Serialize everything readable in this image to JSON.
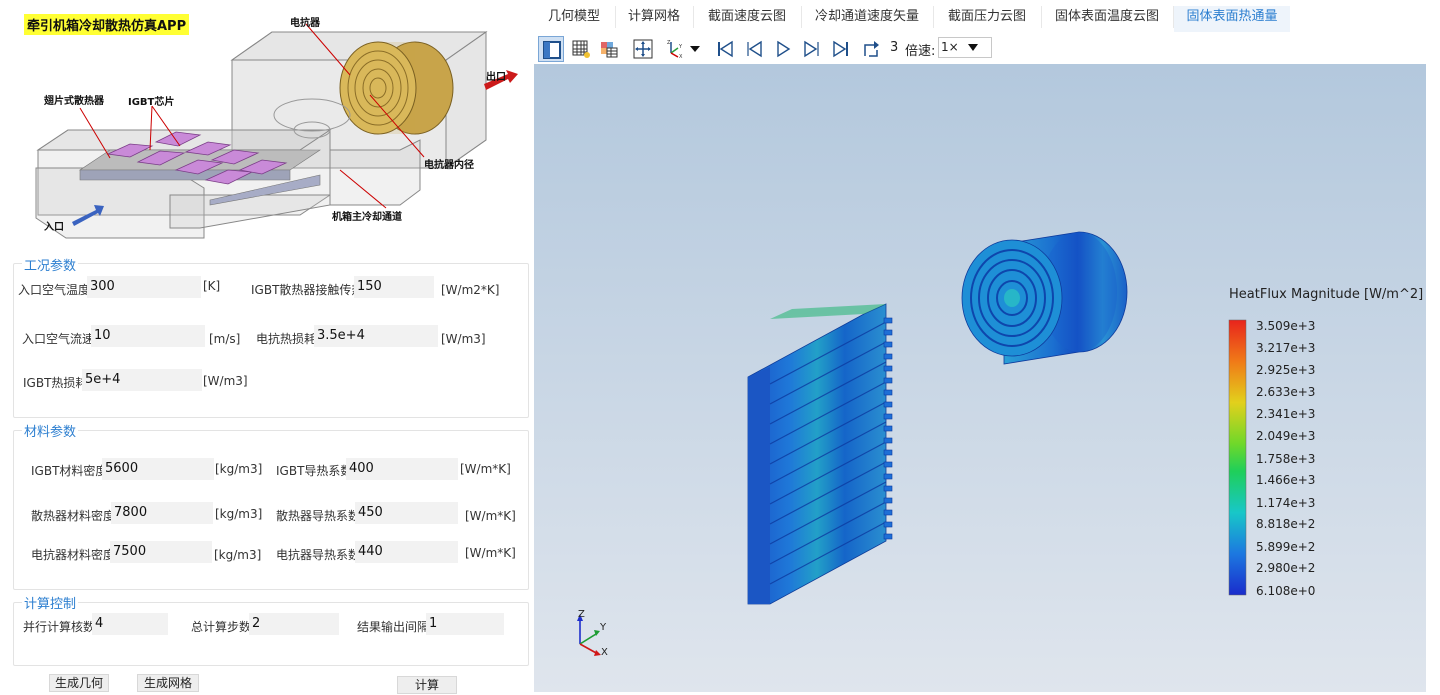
{
  "app": {
    "title": "牵引机箱冷却散热仿真APP"
  },
  "diagram": {
    "labels": {
      "reactor": "电抗器",
      "outlet": "出口",
      "fin_radiator": "翅片式散热器",
      "igbt_chip": "IGBT芯片",
      "reactor_inner": "电抗器内径",
      "inlet": "入口",
      "main_channel": "机箱主冷却通道"
    }
  },
  "conditions": {
    "title": "工况参数",
    "inlet_temp_label": "入口空气温度",
    "inlet_temp_value": "300",
    "inlet_temp_unit": "[K]",
    "igbt_contact_label": "IGBT散热器接触传热",
    "igbt_contact_value": "150",
    "igbt_contact_unit": "[W/m2*K]",
    "inlet_speed_label": "入口空气流速",
    "inlet_speed_value": "10",
    "inlet_speed_unit": "[m/s]",
    "reactor_loss_label": "电抗热损耗",
    "reactor_loss_value": "3.5e+4",
    "reactor_loss_unit": "[W/m3]",
    "igbt_loss_label": "IGBT热损耗",
    "igbt_loss_value": "5e+4",
    "igbt_loss_unit": "[W/m3]"
  },
  "materials": {
    "title": "材料参数",
    "igbt_density_label": "IGBT材料密度",
    "igbt_density_value": "5600",
    "igbt_density_unit": "[kg/m3]",
    "igbt_k_label": "IGBT导热系数",
    "igbt_k_value": "400",
    "igbt_k_unit": "[W/m*K]",
    "rad_density_label": "散热器材料密度",
    "rad_density_value": "7800",
    "rad_density_unit": "[kg/m3]",
    "rad_k_label": "散热器导热系数",
    "rad_k_value": "450",
    "rad_k_unit": "[W/m*K]",
    "reac_density_label": "电抗器材料密度",
    "reac_density_value": "7500",
    "reac_density_unit": "[kg/m3]",
    "reac_k_label": "电抗器导热系数",
    "reac_k_value": "440",
    "reac_k_unit": "[W/m*K]"
  },
  "control": {
    "title": "计算控制",
    "cores_label": "并行计算核数",
    "cores_value": "4",
    "steps_label": "总计算步数",
    "steps_value": "2",
    "interval_label": "结果输出间隔",
    "interval_value": "1"
  },
  "buttons": {
    "gen_geometry": "生成几何",
    "gen_mesh": "生成网格",
    "compute": "计算"
  },
  "tabs": [
    {
      "label": "几何模型"
    },
    {
      "label": "计算网格"
    },
    {
      "label": "截面速度云图"
    },
    {
      "label": "冷却通道速度矢量"
    },
    {
      "label": "截面压力云图"
    },
    {
      "label": "固体表面温度云图"
    },
    {
      "label": "固体表面热通量"
    }
  ],
  "active_tab": 6,
  "toolbar": {
    "frame_number": "3",
    "speed_label": "倍速:",
    "speed_value": "1×"
  },
  "legend": {
    "title": "HeatFlux Magnitude [W/m^2]",
    "labels": [
      "3.509e+3",
      "3.217e+3",
      "2.925e+3",
      "2.633e+3",
      "2.341e+3",
      "2.049e+3",
      "1.758e+3",
      "1.466e+3",
      "1.174e+3",
      "8.818e+2",
      "5.899e+2",
      "2.980e+2",
      "6.108e+0"
    ]
  },
  "axes": {
    "z": "Z",
    "y": "Y",
    "x": "X"
  },
  "colors": {
    "accent": "#2d7fd0",
    "title_highlight": "#ffff33"
  }
}
